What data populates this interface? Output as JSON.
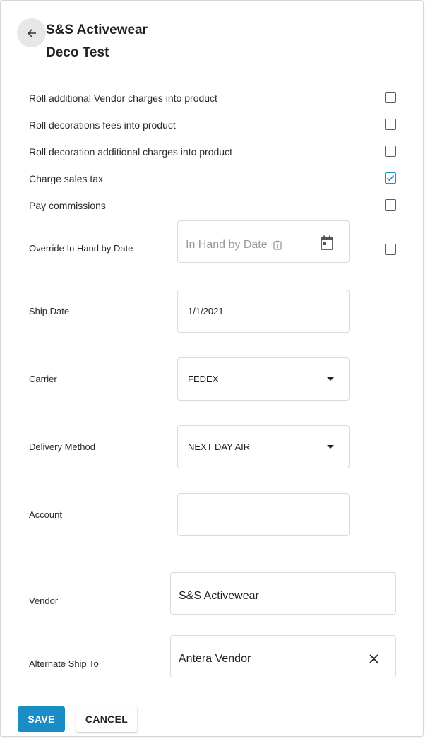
{
  "header": {
    "title": "S&S Activewear",
    "subtitle": "Deco Test"
  },
  "options": [
    {
      "label": "Roll additional Vendor charges into product",
      "checked": false
    },
    {
      "label": "Roll decorations fees into product",
      "checked": false
    },
    {
      "label": "Roll decoration additional charges into product",
      "checked": false
    },
    {
      "label": "Charge sales tax",
      "checked": true
    },
    {
      "label": "Pay commissions",
      "checked": false
    }
  ],
  "override": {
    "label": "Override In Hand by Date",
    "placeholder": "In Hand by Date",
    "checked": false
  },
  "ship_date": {
    "label": "Ship Date",
    "value": "1/1/2021"
  },
  "carrier": {
    "label": "Carrier",
    "value": "FEDEX"
  },
  "delivery_method": {
    "label": "Delivery Method",
    "value": "NEXT DAY AIR"
  },
  "account": {
    "label": "Account",
    "value": ""
  },
  "vendor": {
    "label": "Vendor",
    "value": "S&S Activewear"
  },
  "alternate_ship_to": {
    "label": "Alternate Ship To",
    "value": "Antera Vendor"
  },
  "actions": {
    "save": "SAVE",
    "cancel": "CANCEL"
  },
  "colors": {
    "accent": "#1a8dc6"
  }
}
